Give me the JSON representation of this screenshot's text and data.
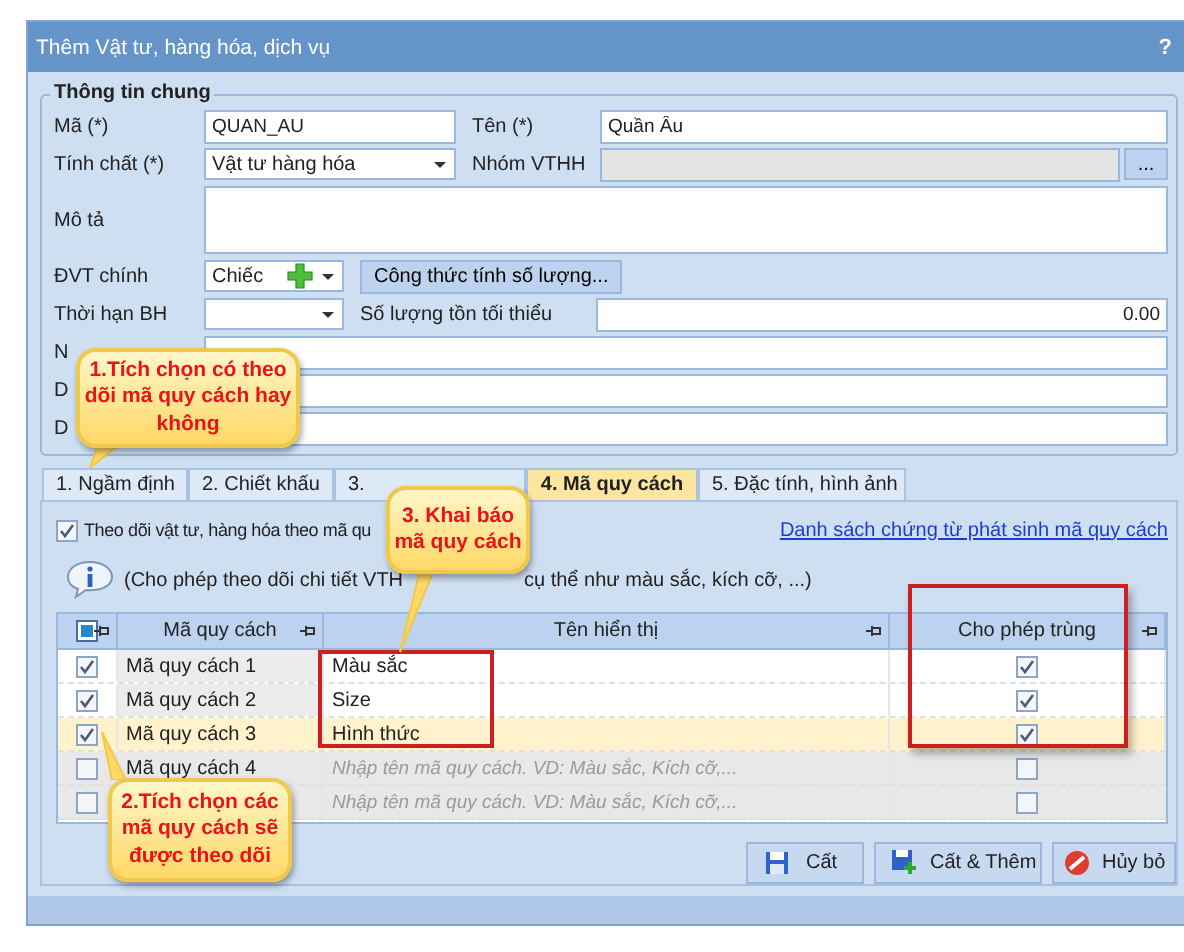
{
  "window": {
    "title": "Thêm Vật tư, hàng hóa, dịch vụ",
    "help": "?"
  },
  "general": {
    "title": "Thông tin chung",
    "code": {
      "label": "Mã (*)",
      "value": "QUAN_AU"
    },
    "name": {
      "label": "Tên (*)",
      "value": "Quần Âu"
    },
    "nature": {
      "label": "Tính chất (*)",
      "value": "Vật tư hàng hóa"
    },
    "group": {
      "label": "Nhóm VTHH",
      "disabled": true,
      "button": "..."
    },
    "description": {
      "label": "Mô tả"
    },
    "unit": {
      "label": "ĐVT chính",
      "value": "Chiếc"
    },
    "formula_button": "Công thức tính số lượng...",
    "warranty": {
      "label": "Thời hạn BH"
    },
    "min_stock": {
      "label": "Số lượng tồn tối thiểu",
      "value": "0.00"
    },
    "extra_rows": [
      {
        "label": "N"
      },
      {
        "label": "D"
      },
      {
        "label": "D"
      }
    ]
  },
  "tabs": [
    {
      "label": "1. Ngầm định",
      "selected": false
    },
    {
      "label": "2. Chiết khấu",
      "selected": false
    },
    {
      "label": "3.",
      "selected": false
    },
    {
      "label": "4. Mã quy cách",
      "selected": true
    },
    {
      "label": "5. Đặc tính, hình ảnh",
      "selected": false
    }
  ],
  "spec_tab": {
    "track": {
      "label": "Theo dõi vật tư, hàng hóa theo mã qu",
      "checked": true
    },
    "link": "Danh sách chứng từ phát sinh mã quy cách",
    "info_parts": [
      "(Cho phép theo dõi chi tiết VTH",
      "cụ thể như màu sắc, kích cỡ, ...)"
    ],
    "grid": {
      "columns": [
        {
          "label": "Mã quy cách"
        },
        {
          "label": "Tên hiển thị"
        },
        {
          "label": "Cho phép trùng"
        }
      ],
      "rows": [
        {
          "checked": true,
          "code": "Mã quy cách 1",
          "display_name": "Màu sắc",
          "allow_duplicate": true,
          "selected": false,
          "disabled": false
        },
        {
          "checked": true,
          "code": "Mã quy cách 2",
          "display_name": "Size",
          "allow_duplicate": true,
          "selected": false,
          "disabled": false
        },
        {
          "checked": true,
          "code": "Mã quy cách 3",
          "display_name": "Hình thức",
          "allow_duplicate": true,
          "selected": true,
          "disabled": false
        },
        {
          "checked": false,
          "code": "Mã quy cách 4",
          "placeholder": "Nhập tên mã quy cách. VD: Màu sắc, Kích cỡ,...",
          "allow_duplicate": false,
          "selected": false,
          "disabled": true
        },
        {
          "checked": false,
          "placeholder": "Nhập tên mã quy cách. VD: Màu sắc, Kích cỡ,...",
          "allow_duplicate": false,
          "selected": false,
          "disabled": true
        }
      ]
    }
  },
  "buttons": [
    {
      "label": "Cất",
      "kind": "save"
    },
    {
      "label": "Cất & Thêm",
      "kind": "save_new"
    },
    {
      "label": "Hủy bỏ",
      "kind": "cancel"
    }
  ],
  "callouts": [
    {
      "text": "1.Tích chọn có theo dõi mã quy cách hay không"
    },
    {
      "text": "2.Tích chọn các mã quy cách sẽ được theo dõi"
    },
    {
      "text": "3. Khai báo mã quy cách"
    }
  ]
}
